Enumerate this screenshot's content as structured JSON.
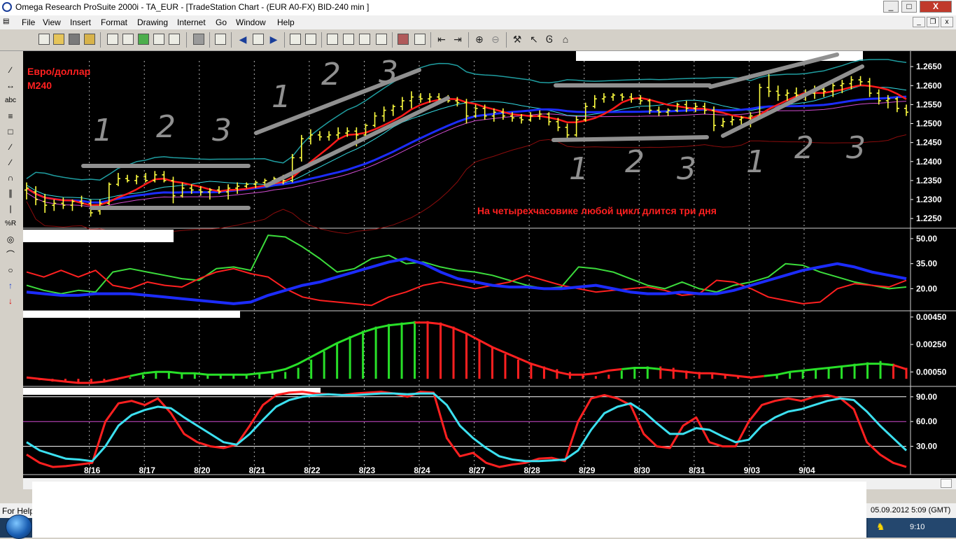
{
  "window": {
    "title": "Omega Research ProSuite 2000i - TA_EUR - [TradeStation Chart - (EUR A0-FX)  BID-240 min ]",
    "minimize_label": "_",
    "maximize_label": "□",
    "close_label": "X",
    "close_color": "#c0392b"
  },
  "menu": {
    "items": [
      "File",
      "View",
      "Insert",
      "Format",
      "Drawing",
      "Internet",
      "Go",
      "Window",
      "Help"
    ],
    "mdi_minimize_label": "_",
    "mdi_restore_label": "❐",
    "mdi_close_label": "x"
  },
  "toolbar": {
    "icons": [
      "new-document-icon",
      "open-folder-icon",
      "save-all-icon",
      "open-workspace-icon",
      "print-preview-icon",
      "chart-icon",
      "record-icon",
      "edit-icon",
      "scan-icon",
      "options-icon",
      "print-icon",
      "properties-icon",
      "back-icon",
      "forward-icon",
      "layout-icon",
      "insert-chart-icon",
      "grid-icon",
      "window-icon",
      "table-icon",
      "prev-bar-icon",
      "next-bar-icon",
      "zoom-in-icon",
      "zoom-out-icon",
      "hammer-icon",
      "pointer-icon",
      "cursor-text-icon",
      "hat-icon"
    ]
  },
  "left_tools": {
    "items": [
      "∕",
      "↔",
      "abc",
      "≡",
      "□",
      "∕",
      "∕",
      "∩",
      "∥",
      "|",
      "%R",
      "◎",
      "⌒",
      "○",
      "↑",
      "↓"
    ]
  },
  "chart": {
    "colors": {
      "background": "#000000",
      "bars": "#ffff40",
      "price_ma_red": "#ff1a1a",
      "price_ma_blue": "#1c2cff",
      "price_ma_teal": "#1f9da0",
      "price_ma_cyan": "#34d8e0",
      "price_ma_magenta": "#d04cd0",
      "price_ma_darkred": "#8b0c0c",
      "dmi_green": "#3cdc3c",
      "dmi_red": "#ff2020",
      "dmi_blue": "#1c2cff",
      "hist_green": "#28e028",
      "hist_red": "#ff2020",
      "stoch_red": "#ff2020",
      "stoch_cyan": "#3ce0f0",
      "annotation_red": "#ff2020",
      "trend_gray": "#909090",
      "axis_text": "#ffffff",
      "header_fill": "#ffffff"
    },
    "annotation_top_left": [
      "Евро/доллар",
      "M240"
    ],
    "annotation_main": "На четырехчасовике любой цикл длится три дня",
    "hand_numbers": [
      "1",
      "2",
      "3",
      "1",
      "2",
      "3",
      "1",
      "2",
      "3",
      "1",
      "2",
      "3"
    ],
    "price_axis": [
      "1.2650",
      "1.2600",
      "1.2550",
      "1.2500",
      "1.2450",
      "1.2400",
      "1.2350",
      "1.2300",
      "1.2250"
    ],
    "dmi_axis": [
      "50.00",
      "35.00",
      "20.00"
    ],
    "macd_axis": [
      "0.00450",
      "0.00250",
      "0.00050"
    ],
    "stoch_axis": [
      "90.00",
      "60.00",
      "30.00"
    ],
    "dates": [
      "8/16",
      "8/17",
      "8/20",
      "8/21",
      "8/22",
      "8/23",
      "8/24",
      "8/27",
      "8/28",
      "8/29",
      "8/30",
      "8/31",
      "9/03",
      "9/04"
    ],
    "ohlc_bars": [
      [
        1.2325,
        1.2345,
        1.23,
        1.233
      ],
      [
        1.232,
        1.2335,
        1.2285,
        1.23
      ],
      [
        1.2295,
        1.2315,
        1.2265,
        1.2285
      ],
      [
        1.2285,
        1.23,
        1.227,
        1.229
      ],
      [
        1.229,
        1.2305,
        1.2275,
        1.2285
      ],
      [
        1.2285,
        1.23,
        1.227,
        1.2295
      ],
      [
        1.2295,
        1.231,
        1.228,
        1.229
      ],
      [
        1.229,
        1.23,
        1.2255,
        1.2265
      ],
      [
        1.227,
        1.23,
        1.226,
        1.229
      ],
      [
        1.229,
        1.2345,
        1.2285,
        1.234
      ],
      [
        1.234,
        1.237,
        1.2335,
        1.2355
      ],
      [
        1.2355,
        1.2365,
        1.2345,
        1.235
      ],
      [
        1.235,
        1.2365,
        1.234,
        1.236
      ],
      [
        1.236,
        1.237,
        1.2345,
        1.235
      ],
      [
        1.235,
        1.2375,
        1.2345,
        1.2365
      ],
      [
        1.2365,
        1.2375,
        1.2345,
        1.235
      ],
      [
        1.235,
        1.236,
        1.229,
        1.231
      ],
      [
        1.231,
        1.2345,
        1.2305,
        1.233
      ],
      [
        1.233,
        1.234,
        1.2315,
        1.2325
      ],
      [
        1.2325,
        1.2335,
        1.231,
        1.232
      ],
      [
        1.232,
        1.233,
        1.23,
        1.2325
      ],
      [
        1.2325,
        1.2335,
        1.2315,
        1.232
      ],
      [
        1.232,
        1.234,
        1.23,
        1.233
      ],
      [
        1.233,
        1.2345,
        1.2315,
        1.2335
      ],
      [
        1.2335,
        1.2345,
        1.233,
        1.234
      ],
      [
        1.234,
        1.235,
        1.233,
        1.2345
      ],
      [
        1.2345,
        1.2355,
        1.2335,
        1.235
      ],
      [
        1.235,
        1.236,
        1.234,
        1.2355
      ],
      [
        1.2355,
        1.2365,
        1.234,
        1.235
      ],
      [
        1.235,
        1.242,
        1.2345,
        1.241
      ],
      [
        1.241,
        1.247,
        1.24,
        1.246
      ],
      [
        1.246,
        1.2485,
        1.2445,
        1.247
      ],
      [
        1.247,
        1.248,
        1.2455,
        1.2465
      ],
      [
        1.2465,
        1.248,
        1.2455,
        1.247
      ],
      [
        1.247,
        1.249,
        1.246,
        1.2475
      ],
      [
        1.2475,
        1.249,
        1.2465,
        1.248
      ],
      [
        1.248,
        1.249,
        1.244,
        1.247
      ],
      [
        1.247,
        1.25,
        1.2465,
        1.2495
      ],
      [
        1.2495,
        1.253,
        1.249,
        1.252
      ],
      [
        1.252,
        1.2545,
        1.2505,
        1.2535
      ],
      [
        1.2535,
        1.255,
        1.252,
        1.2545
      ],
      [
        1.2545,
        1.257,
        1.2535,
        1.256
      ],
      [
        1.256,
        1.2585,
        1.254,
        1.257
      ],
      [
        1.257,
        1.258,
        1.2555,
        1.2565
      ],
      [
        1.2565,
        1.258,
        1.2555,
        1.257
      ],
      [
        1.257,
        1.258,
        1.256,
        1.2565
      ],
      [
        1.2565,
        1.2575,
        1.2555,
        1.256
      ],
      [
        1.256,
        1.257,
        1.2545,
        1.2555
      ],
      [
        1.2555,
        1.2565,
        1.25,
        1.252
      ],
      [
        1.252,
        1.255,
        1.2515,
        1.254
      ],
      [
        1.254,
        1.255,
        1.251,
        1.252
      ],
      [
        1.252,
        1.254,
        1.2505,
        1.253
      ],
      [
        1.253,
        1.254,
        1.251,
        1.252
      ],
      [
        1.252,
        1.253,
        1.2505,
        1.2515
      ],
      [
        1.2515,
        1.2525,
        1.25,
        1.251
      ],
      [
        1.251,
        1.253,
        1.2505,
        1.252
      ],
      [
        1.252,
        1.2535,
        1.251,
        1.2525
      ],
      [
        1.2525,
        1.253,
        1.2495,
        1.2505
      ],
      [
        1.2505,
        1.2515,
        1.248,
        1.249
      ],
      [
        1.249,
        1.25,
        1.246,
        1.247
      ],
      [
        1.247,
        1.252,
        1.2465,
        1.251
      ],
      [
        1.251,
        1.2555,
        1.2505,
        1.2545
      ],
      [
        1.2545,
        1.2575,
        1.254,
        1.2565
      ],
      [
        1.2565,
        1.258,
        1.2555,
        1.257
      ],
      [
        1.257,
        1.258,
        1.256,
        1.2575
      ],
      [
        1.2575,
        1.258,
        1.256,
        1.257
      ],
      [
        1.257,
        1.258,
        1.2555,
        1.2565
      ],
      [
        1.2565,
        1.2575,
        1.255,
        1.256
      ],
      [
        1.256,
        1.2565,
        1.2525,
        1.2535
      ],
      [
        1.2535,
        1.2545,
        1.252,
        1.253
      ],
      [
        1.253,
        1.254,
        1.252,
        1.2535
      ],
      [
        1.2535,
        1.2555,
        1.253,
        1.255
      ],
      [
        1.255,
        1.256,
        1.253,
        1.254
      ],
      [
        1.254,
        1.2555,
        1.253,
        1.2545
      ],
      [
        1.2545,
        1.2555,
        1.2525,
        1.2535
      ],
      [
        1.2535,
        1.2545,
        1.248,
        1.2495
      ],
      [
        1.2495,
        1.2515,
        1.249,
        1.2505
      ],
      [
        1.2505,
        1.252,
        1.2495,
        1.251
      ],
      [
        1.251,
        1.252,
        1.249,
        1.2515
      ],
      [
        1.2515,
        1.253,
        1.249,
        1.252
      ],
      [
        1.252,
        1.2605,
        1.2515,
        1.2595
      ],
      [
        1.2595,
        1.263,
        1.257,
        1.2585
      ],
      [
        1.2585,
        1.26,
        1.256,
        1.2575
      ],
      [
        1.2575,
        1.259,
        1.256,
        1.258
      ],
      [
        1.258,
        1.2595,
        1.2565,
        1.2575
      ],
      [
        1.2575,
        1.259,
        1.256,
        1.258
      ],
      [
        1.258,
        1.26,
        1.2565,
        1.259
      ],
      [
        1.259,
        1.2605,
        1.257,
        1.2585
      ],
      [
        1.2585,
        1.261,
        1.257,
        1.26
      ],
      [
        1.26,
        1.2615,
        1.258,
        1.2605
      ],
      [
        1.2605,
        1.2625,
        1.259,
        1.2615
      ],
      [
        1.2615,
        1.2625,
        1.26,
        1.261
      ],
      [
        1.261,
        1.262,
        1.257,
        1.258
      ],
      [
        1.258,
        1.259,
        1.255,
        1.256
      ],
      [
        1.256,
        1.2575,
        1.254,
        1.2565
      ],
      [
        1.2565,
        1.257,
        1.253,
        1.254
      ],
      [
        1.254,
        1.255,
        1.252,
        1.253
      ]
    ]
  },
  "status": {
    "left": "For Help",
    "datetime": "05.09.2012 5:09 (GMT)",
    "clock": "9:10"
  }
}
